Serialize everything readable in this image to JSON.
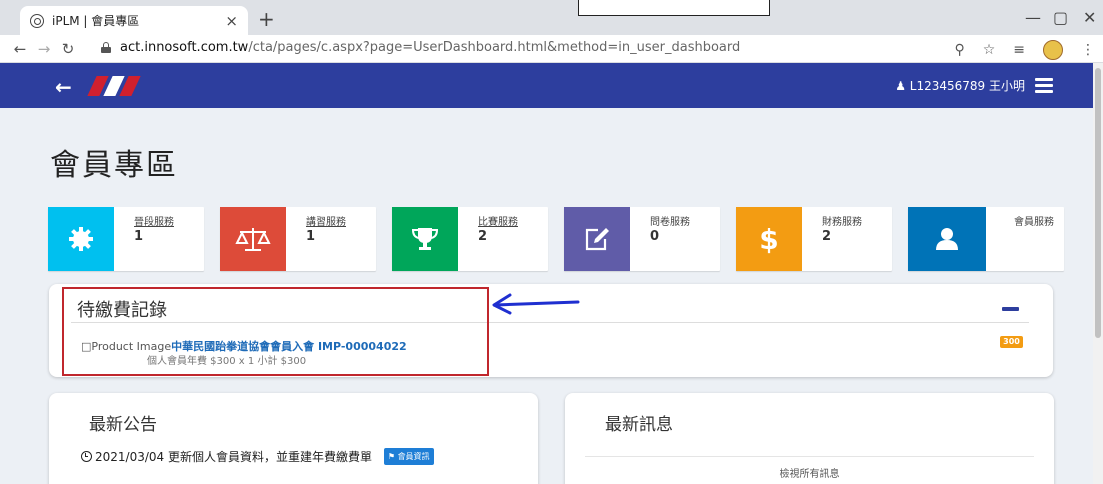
{
  "browser": {
    "tab_title": "iPLM | 會員專區",
    "tab_close": "×",
    "new_tab": "+",
    "url_host": "act.innosoft.com.tw",
    "url_path": "/cta/pages/c.aspx?page=UserDashboard.html&method=in_user_dashboard",
    "window_controls": [
      "—",
      "▢",
      "✕"
    ]
  },
  "header": {
    "back": "←",
    "user": "L123456789 王小明",
    "brand_colors": [
      "#d0202e",
      "#ffffff",
      "#d0202e"
    ]
  },
  "page": {
    "title": "會員專區"
  },
  "stats": [
    {
      "label": "晉段服務",
      "value": "1",
      "color": "#00c0ef",
      "icon": "gear-icon"
    },
    {
      "label": "講習服務",
      "value": "1",
      "color": "#dd4b39",
      "icon": "balance-scale-icon"
    },
    {
      "label": "比賽服務",
      "value": "2",
      "color": "#00a65a",
      "icon": "trophy-icon"
    },
    {
      "label": "問卷服務",
      "value": "0",
      "color": "#605ca8",
      "icon": "edit-icon"
    },
    {
      "label": "財務服務",
      "value": "2",
      "color": "#f39c12",
      "icon": "dollar-icon"
    },
    {
      "label": "會員服務",
      "value": "",
      "color": "#0073b7",
      "icon": "user-icon"
    }
  ],
  "pending": {
    "title": "待繳費記錄",
    "collapse": "—",
    "image_alt": "Product Image",
    "product_name": "中華民國跆拳道協會會員入會 IMP-00004022",
    "description": "個人會員年費 $300 x 1 小計 $300",
    "price": "300"
  },
  "news": {
    "title": "最新公告",
    "item_date": "2021/03/04",
    "item_text": "更新個人會員資料，並重建年費繳費單",
    "item_tag": "會員資訊"
  },
  "messages": {
    "title": "最新訊息",
    "view_all": "檢視所有訊息"
  }
}
